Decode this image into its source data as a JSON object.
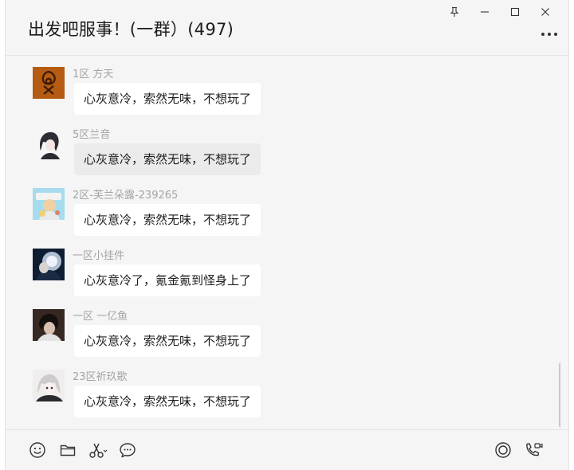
{
  "chat": {
    "title": "出发吧服事！(一群）(497)"
  },
  "messages": [
    {
      "sender": "1区 方天",
      "text": "心灰意冷，索然无味，不想玩了"
    },
    {
      "sender": "5区兰音",
      "text": "心灰意冷，索然无味，不想玩了"
    },
    {
      "sender": "2区-芙兰朵露-239265",
      "text": "心灰意冷，索然无味，不想玩了"
    },
    {
      "sender": "一区小挂件",
      "text": "心灰意冷了，氪金氪到怪身上了"
    },
    {
      "sender": "一区 一亿鱼",
      "text": "心灰意冷，索然无味，不想玩了"
    },
    {
      "sender": "23区祈玖歌",
      "text": "心灰意冷，索然无味，不想玩了"
    }
  ],
  "icons": {
    "window": [
      "pin-icon",
      "minimize-icon",
      "maximize-icon",
      "close-icon"
    ],
    "toolbar_left": [
      "emoji-icon",
      "folder-icon",
      "scissors-icon",
      "chat-bubble-icon"
    ],
    "toolbar_right": [
      "live-icon",
      "phone-video-icon"
    ]
  },
  "colors": {
    "window_bg": "#f5f5f5",
    "bubble_bg": "#ffffff",
    "bubble_hover": "#ebebeb",
    "sender_text": "#a4a4a4"
  }
}
